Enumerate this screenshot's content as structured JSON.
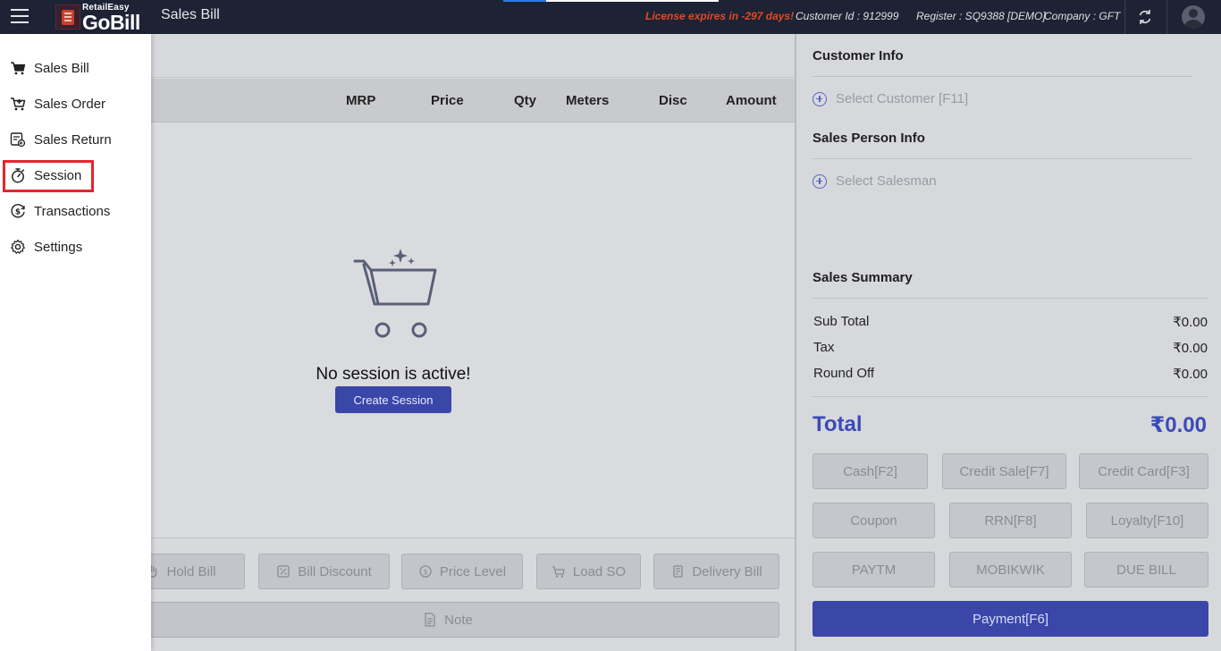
{
  "topbar": {
    "logo_small": "RetailEasy",
    "logo_big": "GoBill",
    "title": "Sales Bill",
    "license": "License expires in -297 days!",
    "customer_id": "Customer Id : 912999",
    "register": "Register : SQ9388 [DEMO]",
    "company": "Company : GFT"
  },
  "sidebar": {
    "items": [
      {
        "label": "Sales Bill",
        "icon": "cart-icon"
      },
      {
        "label": "Sales Order",
        "icon": "cart-plus-icon"
      },
      {
        "label": "Sales Return",
        "icon": "return-icon"
      },
      {
        "label": "Session",
        "icon": "stopwatch-icon"
      },
      {
        "label": "Transactions",
        "icon": "dollar-circle-icon"
      },
      {
        "label": "Settings",
        "icon": "gear-icon"
      }
    ],
    "highlighted": "Session"
  },
  "table": {
    "headers": [
      "MRP",
      "Price",
      "Qty",
      "Meters",
      "Disc",
      "Amount"
    ]
  },
  "empty_state": {
    "message": "No session is active!",
    "button": "Create Session"
  },
  "bottom_buttons": {
    "hold_bill": "Hold Bill",
    "bill_discount": "Bill Discount",
    "price_level": "Price Level",
    "load_so": "Load SO",
    "delivery_bill": "Delivery Bill",
    "note": "Note"
  },
  "right_panel": {
    "customer_info_title": "Customer Info",
    "select_customer": "Select Customer [F11]",
    "sales_person_title": "Sales Person Info",
    "select_salesman": "Select Salesman",
    "summary_title": "Sales Summary",
    "sub_total_label": "Sub Total",
    "sub_total": "₹0.00",
    "tax_label": "Tax",
    "tax": "₹0.00",
    "round_off_label": "Round Off",
    "round_off": "₹0.00",
    "total_label": "Total",
    "total": "₹0.00"
  },
  "payment_buttons": {
    "cash": "Cash[F2]",
    "credit_sale": "Credit Sale[F7]",
    "credit_card": "Credit Card[F3]",
    "coupon": "Coupon",
    "rrn": "RRN[F8]",
    "loyalty": "Loyalty[F10]",
    "paytm": "PAYTM",
    "mobikwik": "MOBIKWIK",
    "due_bill": "DUE BILL",
    "payment": "Payment[F6]"
  },
  "colors": {
    "topbar": "#1e2235",
    "accent": "#3a46a8",
    "license_warning": "#e24a1f",
    "highlight": "#e8232b"
  }
}
